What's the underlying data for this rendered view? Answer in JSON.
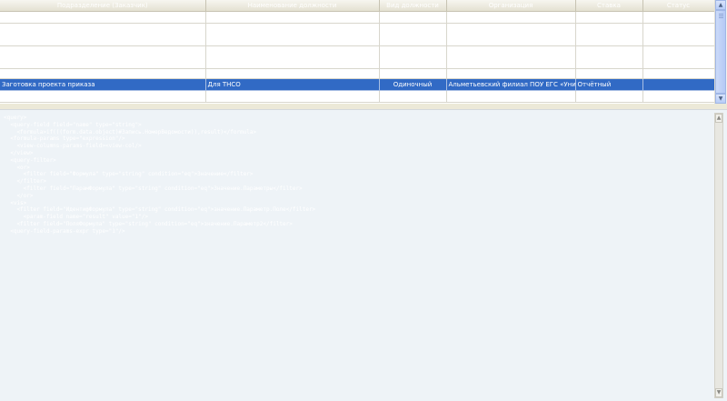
{
  "grid": {
    "columns": [
      "Подразделение (Заказчик)",
      "Наименование должности",
      "Вид должности",
      "Организация",
      "Ставка",
      "Статус"
    ],
    "rows": [
      [
        "",
        "",
        "",
        "",
        "",
        ""
      ],
      [
        "",
        "",
        "",
        "",
        "",
        ""
      ],
      [
        "",
        "",
        "",
        "",
        "",
        ""
      ],
      [
        "",
        "",
        "",
        "",
        "",
        ""
      ],
      [
        "Заготовка проекта приказа",
        "Для ТНСО",
        "Одиночный",
        "Альметьевский филиал ПОУ ЕГС «Универс",
        "Отчётный",
        ""
      ],
      [
        "",
        "",
        "",
        "",
        "",
        ""
      ]
    ],
    "selected_row_index": 4,
    "scroll_up": "▲",
    "scroll_down": "▼"
  },
  "code": {
    "lines": [
      "<query>",
      "  <query-field field=\"name\" type=\"string\">",
      "    <formula>if(((form.data.object)#Запись.НомерВедомости)),result)</formula>",
      "  <formula-params type=\"expression\"/>",
      "    <view-columns-params-field><view-col/>",
      "  </view>",
      "  <query-filter>",
      "    <or>",
      "      <filter field=\"Формула\" type=\"string\" condition=\"eq\">Значение</filter>",
      "    </filter>",
      "      <filter field=\"ПарамФормула\" type=\"string\" condition=\"eq\">Значение.Параметры</filter>",
      "    </or>",
      "  <vis>",
      "    <filter field=\"ИдентифФормула\" type=\"string\" condition=\"eq\">значение.Параметр.Поле</filter>",
      "      <param-field name=\"result\" value=\"1\"/>",
      "    <filter field=\"ПоляФормула\" type=\"string\" condition=\"eq\">значение.Параметр2</filter>",
      "  <query-field-params-expr type=\"1\"/>"
    ],
    "scroll_up": "▲",
    "scroll_down": "▼"
  }
}
